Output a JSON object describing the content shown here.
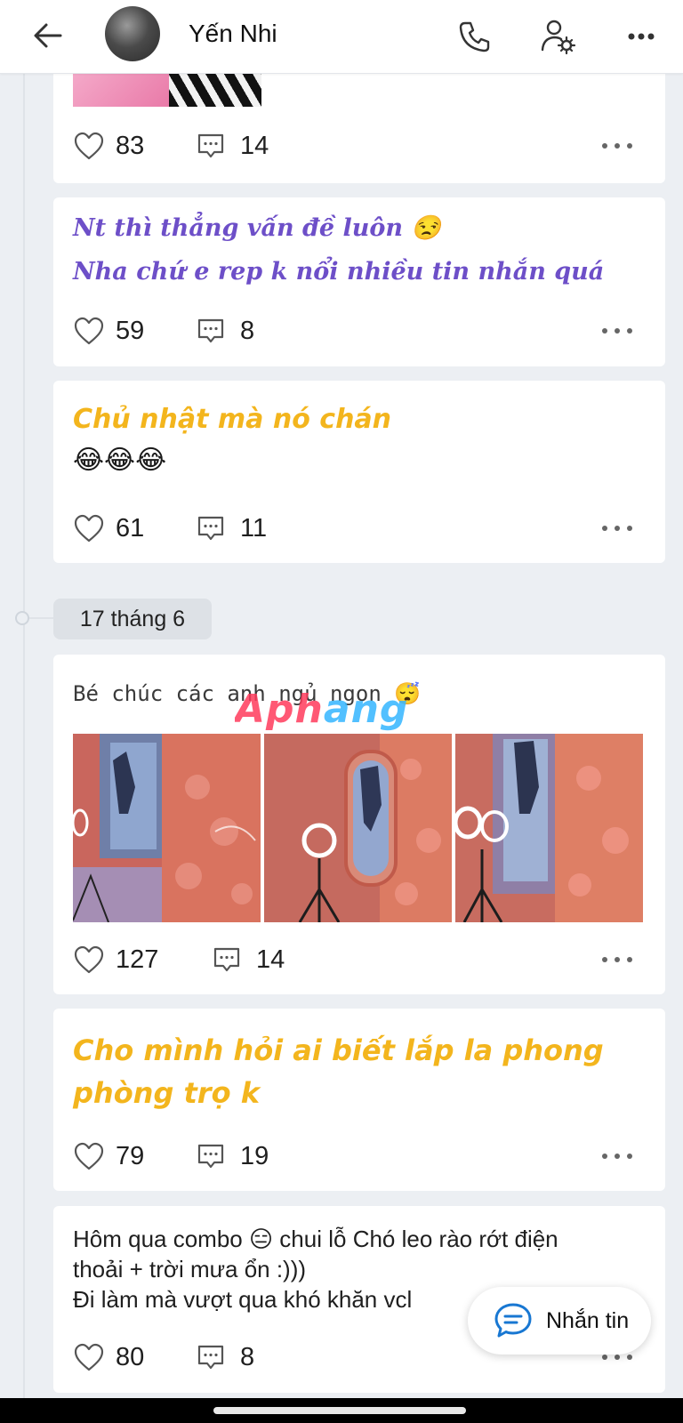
{
  "header": {
    "profile_name": "Yến Nhi",
    "icons": [
      "arrow-left-icon",
      "phone-icon",
      "user-gear-icon",
      "more-dots-icon"
    ]
  },
  "posts": [
    {
      "id": "post1",
      "likes": "83",
      "comments": "14"
    },
    {
      "id": "post2",
      "lines": [
        "Nt thì thẳng vấn đề luôn 😒",
        "Nha chứ e rep k nổi nhiều tin nhắn quá"
      ],
      "likes": "59",
      "comments": "8"
    },
    {
      "id": "post3",
      "lines": [
        "Chủ nhật mà nó chán",
        "😂😂😂"
      ],
      "likes": "61",
      "comments": "11"
    },
    {
      "id": "post4",
      "caption": "Bé chúc các anh ngủ ngon 😴",
      "likes": "127",
      "comments": "14",
      "photos_count": 3
    },
    {
      "id": "post5",
      "lines": [
        "Cho mình hỏi ai biết lắp la phong",
        "phòng trọ k"
      ],
      "likes": "79",
      "comments": "19"
    },
    {
      "id": "post6",
      "lines": [
        "Hôm qua combo 😑 chui lỗ Chó leo rào rớt điện",
        "thoải + trời mưa ổn :)))",
        "Đi làm mà vượt qua khó khăn vcl"
      ],
      "likes": "80",
      "comments": "8"
    }
  ],
  "date_separator": "17 tháng 6",
  "watermark": "Aphang",
  "fab": {
    "label": "Nhắn tin"
  },
  "colors": {
    "purple_text": "#6d4fc8",
    "yellow_text": "#f3b51d",
    "background": "#eceff3",
    "card": "#ffffff"
  }
}
